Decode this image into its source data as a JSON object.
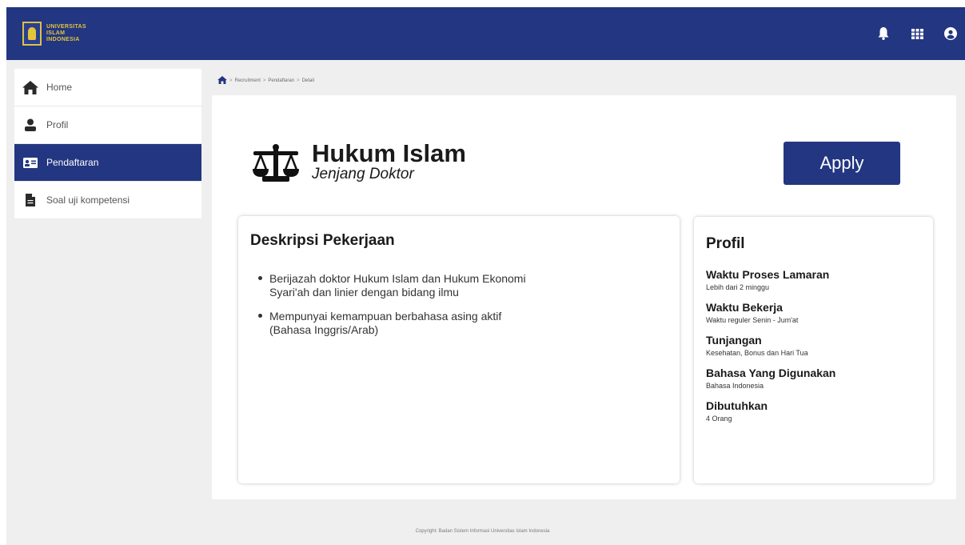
{
  "brand": {
    "logo_lines": [
      "UNIVERSITAS",
      "ISLAM",
      "INDONESIA"
    ],
    "primary_color": "#233681",
    "logo_color": "#e3c53c"
  },
  "topbar": {
    "icons": [
      "bell-icon",
      "apps-grid-icon",
      "user-account-icon"
    ]
  },
  "sidebar": {
    "items": [
      {
        "label": "Home",
        "icon": "home-icon",
        "active": false
      },
      {
        "label": "Profil",
        "icon": "person-icon",
        "active": false
      },
      {
        "label": "Pendaftaran",
        "icon": "id-card-icon",
        "active": true
      },
      {
        "label": "Soal uji kompetensi",
        "icon": "document-icon",
        "active": false
      }
    ]
  },
  "breadcrumb": {
    "items": [
      "Recruitment",
      "Pendaftaran",
      "Detail"
    ],
    "separator": ">"
  },
  "job": {
    "title": "Hukum Islam",
    "level": "Jenjang Doktor",
    "icon": "balance-scale-icon",
    "apply_label": "Apply"
  },
  "description": {
    "title": "Deskripsi Pekerjaan",
    "items": [
      "Berijazah doktor Hukum Islam dan Hukum Ekonomi Syari'ah dan linier dengan bidang ilmu",
      "Mempunyai kemampuan berbahasa asing aktif (Bahasa Inggris/Arab)"
    ]
  },
  "profile": {
    "title": "Profil",
    "items": [
      {
        "label": "Waktu Proses Lamaran",
        "value": "Lebih dari 2 minggu"
      },
      {
        "label": "Waktu Bekerja",
        "value": "Waktu reguler Senin - Jum'at"
      },
      {
        "label": "Tunjangan",
        "value": "Kesehatan, Bonus dan Hari Tua"
      },
      {
        "label": "Bahasa Yang Digunakan",
        "value": "Bahasa Indonesia"
      },
      {
        "label": "Dibutuhkan",
        "value": "4 Orang"
      }
    ]
  },
  "footer": {
    "text": "Copyright: Badan Sistem Informasi Universitas Islam Indonesia"
  }
}
